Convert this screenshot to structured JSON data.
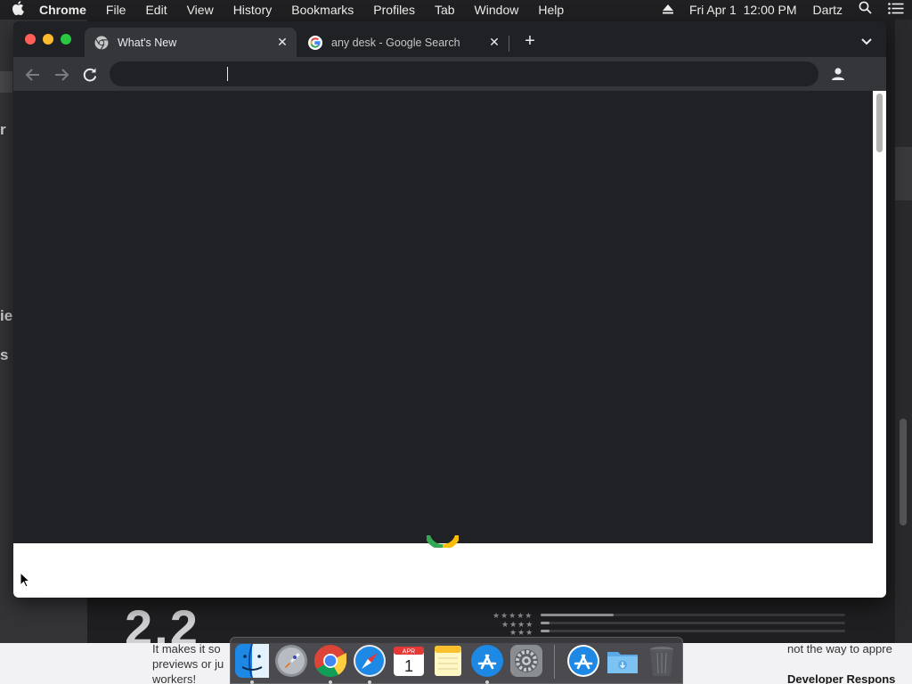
{
  "menubar": {
    "app_name": "Chrome",
    "items": [
      "File",
      "Edit",
      "View",
      "History",
      "Bookmarks",
      "Profiles",
      "Tab",
      "Window",
      "Help"
    ],
    "datetime": "Fri Apr 1  12:00 PM",
    "user": "Dartz"
  },
  "browser": {
    "tabs": [
      {
        "title": "What's New",
        "active": true,
        "favicon": "chrome-logo-icon"
      },
      {
        "title": "any desk - Google Search",
        "active": false,
        "favicon": "google-g-icon"
      }
    ],
    "omnibox": {
      "value": ""
    }
  },
  "background": {
    "left_fragments": [
      "r",
      "ie",
      "s"
    ],
    "rating_number": "2.2",
    "star_rows": [
      "★★★★★",
      "★★★★",
      "★★★"
    ],
    "rating_bars": [
      0.24,
      0.03,
      0.03
    ],
    "review_snippet": [
      "It makes it so",
      "previews or ju",
      "workers!"
    ],
    "right_snippet": "not the way to appre",
    "developer_response": "Developer Respons"
  },
  "dock": {
    "apps": [
      "Finder",
      "Launchpad",
      "Google Chrome",
      "Safari",
      "Calendar",
      "Notes",
      "App Store",
      "System Preferences",
      "App Store",
      "Downloads",
      "Trash"
    ],
    "calendar_month": "APR",
    "calendar_day": "1"
  },
  "colors": {
    "chrome_frame": "#202124",
    "chrome_toolbar": "#35363a",
    "traffic_red": "#ff5f57",
    "traffic_yellow": "#febc2e",
    "traffic_green": "#28c840"
  }
}
